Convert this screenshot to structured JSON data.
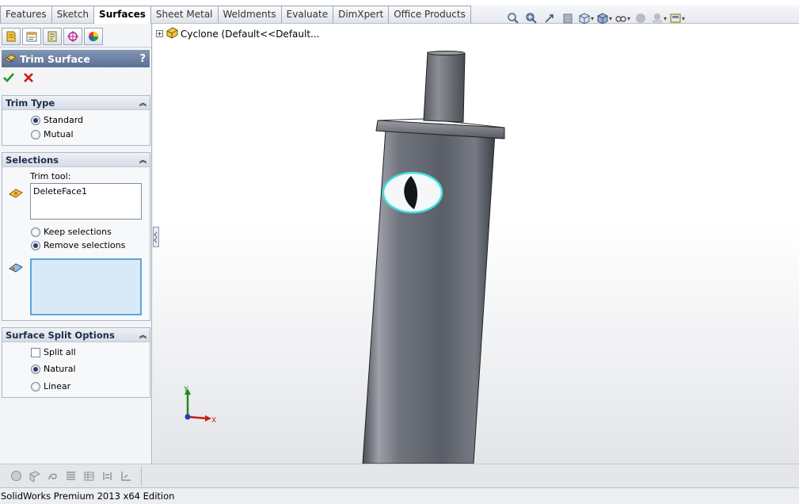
{
  "tabs": [
    {
      "label": "Features",
      "active": false
    },
    {
      "label": "Sketch",
      "active": false
    },
    {
      "label": "Surfaces",
      "active": true
    },
    {
      "label": "Sheet Metal",
      "active": false
    },
    {
      "label": "Weldments",
      "active": false
    },
    {
      "label": "Evaluate",
      "active": false
    },
    {
      "label": "DimXpert",
      "active": false
    },
    {
      "label": "Office Products",
      "active": false
    }
  ],
  "view_tools": [
    "zoom-to-fit-icon",
    "zoom-to-area-icon",
    "previous-view-icon",
    "section-view-icon",
    "view-orientation-icon",
    "display-style-icon",
    "hide-show-items-icon",
    "edit-appearance-icon",
    "apply-scene-icon",
    "view-settings-icon"
  ],
  "property_manager": {
    "title": "Trim Surface",
    "help": "?",
    "ok_icon": "checkmark-icon",
    "cancel_icon": "close-icon"
  },
  "trim_type": {
    "heading": "Trim Type",
    "options": [
      "Standard",
      "Mutual"
    ],
    "selected": "Standard"
  },
  "selections": {
    "heading": "Selections",
    "trim_tool_label": "Trim tool:",
    "trim_tool_items": [
      "DeleteFace1"
    ],
    "options": [
      "Keep selections",
      "Remove selections"
    ],
    "selected": "Remove selections"
  },
  "split_options": {
    "heading": "Surface Split Options",
    "split_all": "Split all",
    "options": [
      "Natural",
      "Linear"
    ],
    "selected": "Natural"
  },
  "tree": {
    "label": "Cyclone  (Default<<Default..."
  },
  "triad": {
    "x": "X",
    "y": "Y"
  },
  "status": "SolidWorks Premium 2013 x64 Edition",
  "colors": {
    "header": "#5b6f92",
    "ok": "#1f9a1f",
    "cancel": "#d21414",
    "highlight": "#3fe0e0"
  }
}
